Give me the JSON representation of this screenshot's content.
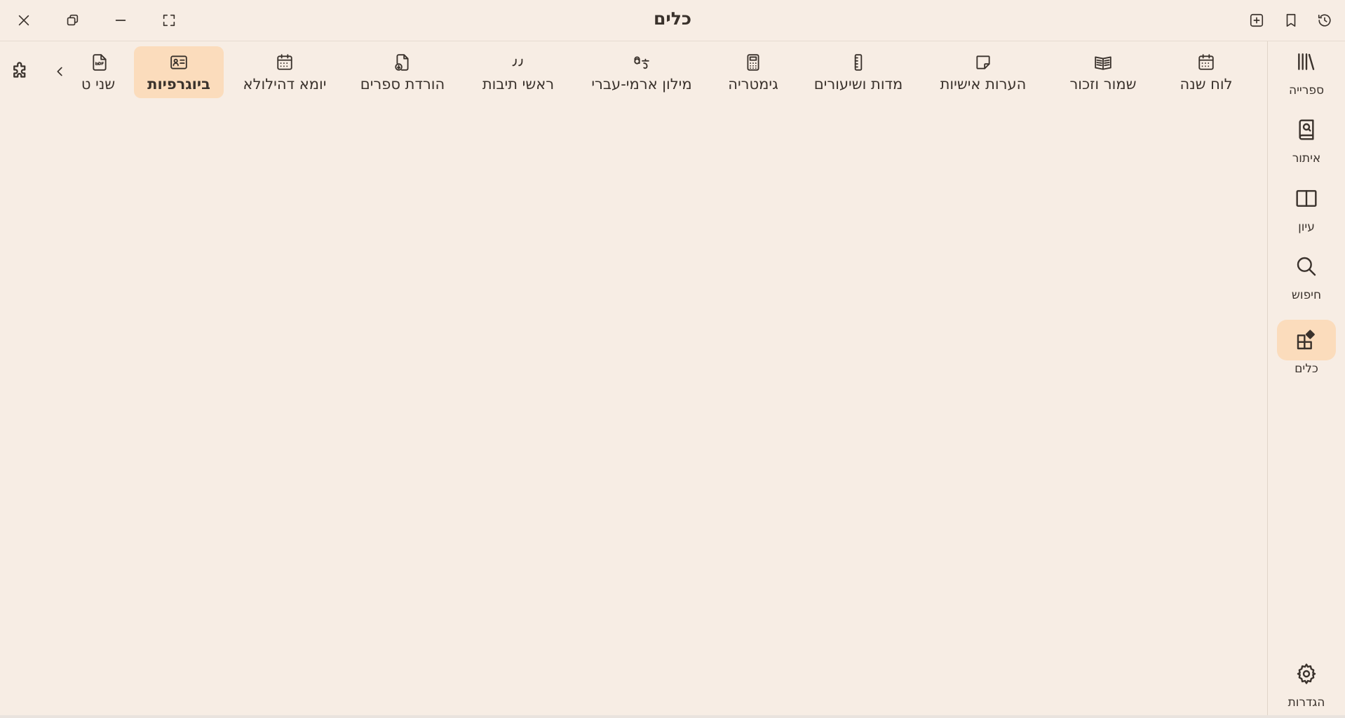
{
  "window": {
    "title": "כלים"
  },
  "rail": {
    "items": [
      {
        "label": "ספרייה",
        "icon": "library-icon"
      },
      {
        "label": "איתור",
        "icon": "book-search-icon"
      },
      {
        "label": "עיון",
        "icon": "open-book-icon"
      },
      {
        "label": "חיפוש",
        "icon": "search-icon"
      },
      {
        "label": "כלים",
        "icon": "tools-grid-icon",
        "active": true
      }
    ],
    "settings": {
      "label": "הגדרות",
      "icon": "gear-icon"
    }
  },
  "tools": [
    {
      "label": "לוח שנה",
      "icon": "calendar-icon"
    },
    {
      "label": "שמור וזכור",
      "icon": "open-book-grid-icon"
    },
    {
      "label": "הערות אישיות",
      "icon": "sticky-note-icon"
    },
    {
      "label": "מדות ושיעורים",
      "icon": "ruler-icon"
    },
    {
      "label": "גימטריה",
      "icon": "calculator-icon"
    },
    {
      "label": "מילון ארמי-עברי",
      "icon": "translate-icon"
    },
    {
      "label": "ראשי תיבות",
      "icon": "quote-icon"
    },
    {
      "label": "הורדת ספרים",
      "icon": "file-download-icon"
    },
    {
      "label": "יומא דהילולא",
      "icon": "calendar-icon"
    },
    {
      "label": "ביוגרפיות",
      "icon": "id-card-icon",
      "active": true
    },
    {
      "label": "שני ט",
      "icon": "pdf-file-icon"
    }
  ],
  "colors": {
    "background": "#f7ede4",
    "accent": "#fbdcbc",
    "text": "#3a322c"
  }
}
